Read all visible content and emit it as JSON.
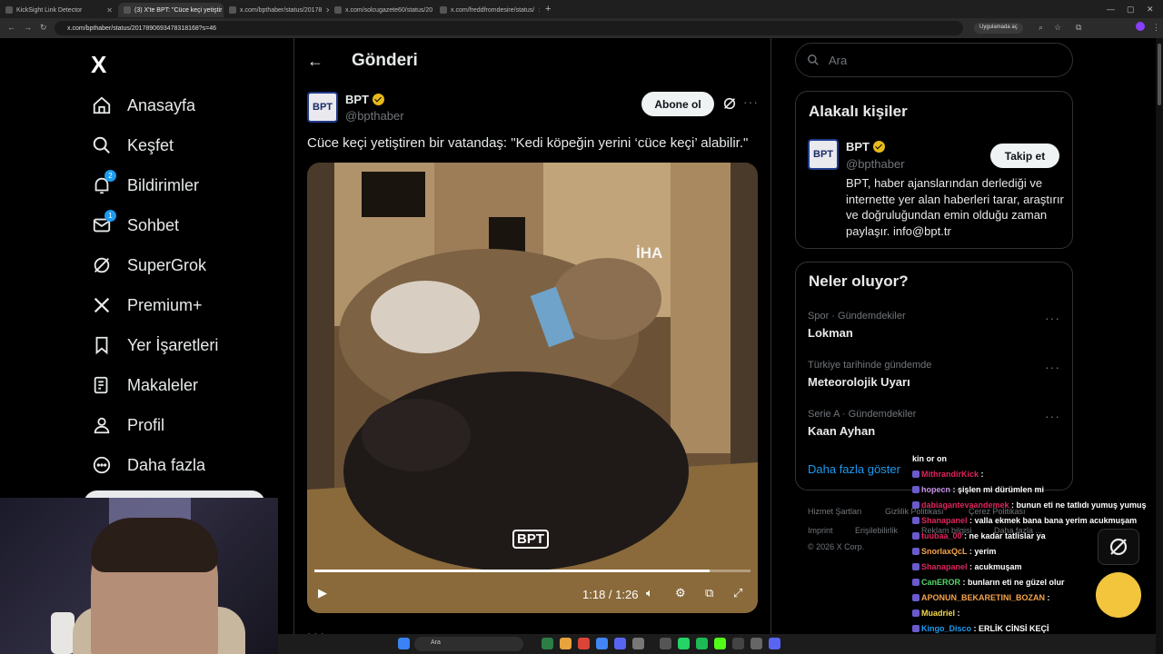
{
  "browser": {
    "tabs": [
      {
        "label": "KickSight Link Detector",
        "active": false
      },
      {
        "label": "(3) X'te BPT: \"Cüce keçi yetiştir",
        "active": true
      },
      {
        "label": "x.com/bpthaber/status/20178",
        "active": false
      },
      {
        "label": "x.com/solcugazete60/status/20",
        "active": false
      },
      {
        "label": "x.com/freddfromdesire/status/",
        "active": false
      }
    ],
    "url": "x.com/bpthaber/status/2017890693478318168?s=46",
    "app_button": "Uygulamada aç"
  },
  "sidebar": {
    "logo": "X",
    "items": [
      {
        "label": "Anasayfa",
        "icon": "home-icon",
        "badge": null
      },
      {
        "label": "Keşfet",
        "icon": "search-icon",
        "badge": null
      },
      {
        "label": "Bildirimler",
        "icon": "bell-icon",
        "badge": "2"
      },
      {
        "label": "Sohbet",
        "icon": "mail-icon",
        "badge": "1"
      },
      {
        "label": "SuperGrok",
        "icon": "grok-icon",
        "badge": null
      },
      {
        "label": "Premium+",
        "icon": "x-logo-icon",
        "badge": null
      },
      {
        "label": "Yer İşaretleri",
        "icon": "bookmark-icon",
        "badge": null
      },
      {
        "label": "Makaleler",
        "icon": "article-icon",
        "badge": null
      },
      {
        "label": "Profil",
        "icon": "person-icon",
        "badge": null
      },
      {
        "label": "Daha fazla",
        "icon": "more-circle-icon",
        "badge": null
      }
    ]
  },
  "main": {
    "title": "Gönderi",
    "post": {
      "author_name": "BPT",
      "author_handle": "@bpthaber",
      "avatar_text": "BPT",
      "subscribe_label": "Abone ol",
      "text": "Cüce keçi yetiştiren bir vatandaş: \"Kedi köpeğin yerini ‘cüce keçi’ alabilir.\"",
      "video": {
        "watermark_top": "İHA",
        "watermark_bottom": "BPT",
        "current_time": "1:18",
        "duration": "1:26",
        "time_display": "1:18 / 1:26",
        "progress_fraction": 0.907
      }
    }
  },
  "right": {
    "search_placeholder": "Ara",
    "related": {
      "title": "Alakalı kişiler",
      "name": "BPT",
      "handle": "@bpthaber",
      "follow_label": "Takip et",
      "bio": "BPT, haber ajanslarından derlediği ve internette yer alan haberleri tarar, araştırır ve doğruluğundan emin olduğu zaman paylaşır. info@bpt.tr"
    },
    "trends": {
      "title": "Neler oluyor?",
      "items": [
        {
          "category": "Spor · Gündemdekiler",
          "name": "Lokman"
        },
        {
          "category": "Türkiye tarihinde gündemde",
          "name": "Meteorolojik Uyarı"
        },
        {
          "category": "Serie A · Gündemdekiler",
          "name": "Kaan Ayhan"
        }
      ],
      "show_more": "Daha fazla göster"
    },
    "footer": {
      "links": [
        "Hizmet Şartları",
        "Gizlilik Politikası",
        "Çerez Politikası",
        "Imprint",
        "Erişilebilirlik",
        "Reklam bilgisi",
        "Daha fazla ..."
      ],
      "copyright": "© 2026 X Corp."
    }
  },
  "overlay": {
    "chat": [
      {
        "user": "",
        "message": "kin or on",
        "color": "#ffffff"
      },
      {
        "user": "MithrandirKick",
        "message": "",
        "color": "#e0245e"
      },
      {
        "user": "hopecn",
        "message": "şişlen mi dürümlen mi",
        "color": "#c792ea"
      },
      {
        "user": "dabiagantevaandemek",
        "message": "bunun eti ne tatlıdı yumuş yumuş",
        "color": "#e0245e"
      },
      {
        "user": "Shanapanel",
        "message": "valla ekmek bana bana yerim acukmuşam",
        "color": "#e0245e"
      },
      {
        "user": "tuubaa_00",
        "message": "ne kadar tatlislar ya",
        "color": "#e0245e"
      },
      {
        "user": "SnorlaxQcL",
        "message": "yerim",
        "color": "#f7a34b"
      },
      {
        "user": "Shanapanel",
        "message": "acukmuşam",
        "color": "#e0245e"
      },
      {
        "user": "CanEROR",
        "message": "bunların eti ne güzel olur",
        "color": "#53d769"
      },
      {
        "user": "APONUN_BEKARETINI_BOZAN",
        "message": "",
        "color": "#f7a34b"
      },
      {
        "user": "Muadriel",
        "message": "",
        "color": "#f7d94b"
      },
      {
        "user": "Kingo_Disco",
        "message": "ERLİK CİNSİ KEÇİ",
        "color": "#1d9bf0"
      }
    ],
    "taskbar_search": "Ara"
  },
  "colors": {
    "accent": "#1d9bf0",
    "background": "#000000",
    "border": "#2f3336",
    "muted": "#71767b",
    "verified": "#e8b91a"
  }
}
